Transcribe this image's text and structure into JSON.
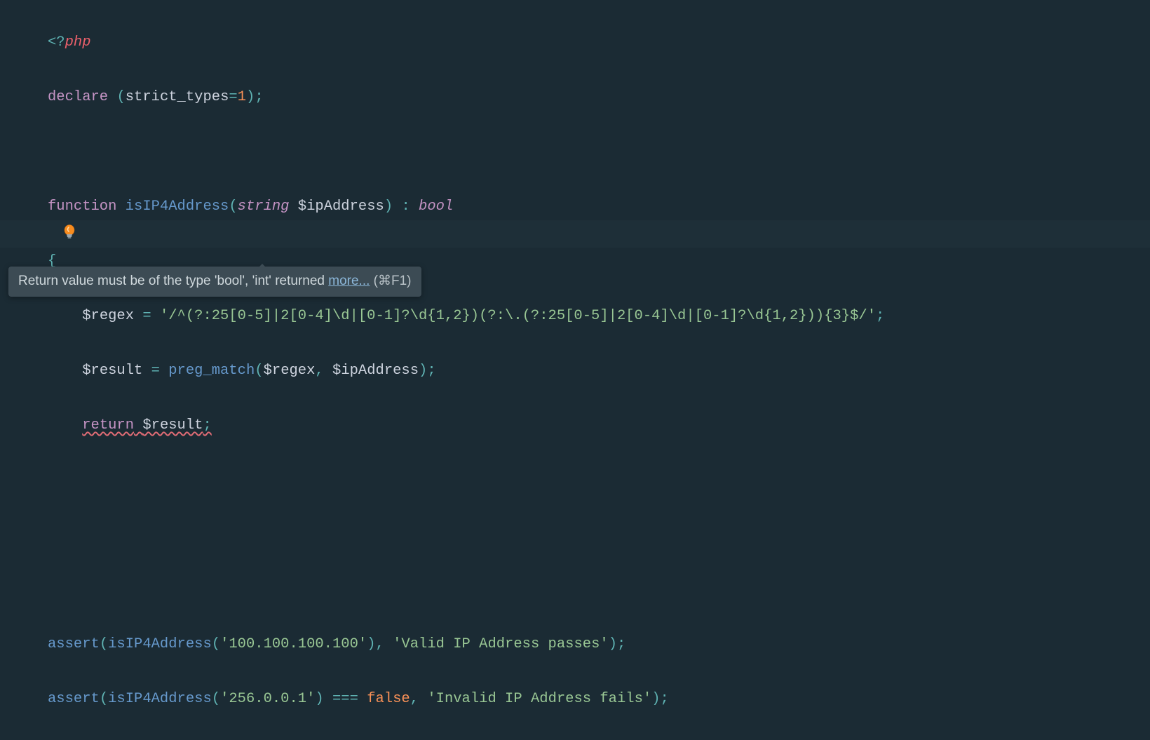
{
  "code": {
    "l1": {
      "open": "<?",
      "php": "php"
    },
    "l2": {
      "declare": "declare",
      "sp": " ",
      "op1": "(",
      "strict": "strict_types",
      "eq": "=",
      "one": "1",
      "op2": ")",
      "semi": ";"
    },
    "l4": {
      "function": "function",
      "name": "isIP4Address",
      "lp": "(",
      "ptype": "string",
      "param": "$ipAddress",
      "rp": ")",
      "colon": " : ",
      "rtype": "bool"
    },
    "l5": {
      "brace": "{"
    },
    "l6": {
      "var": "$regex",
      "eq": " = ",
      "str": "'/^(?:25[0-5]|2[0-4]\\d|[0-1]?\\d{1,2})(?:\\.(?:25[0-5]|2[0-4]\\d|[0-1]?\\d{1,2})){3}$/'",
      "semi": ";"
    },
    "l7": {
      "var": "$result",
      "eq": " = ",
      "fn": "preg_match",
      "lp": "(",
      "a1": "$regex",
      "comma": ", ",
      "a2": "$ipAddress",
      "rp": ")",
      "semi": ";"
    },
    "l8": {
      "return": "return",
      "sp": " ",
      "var": "$result",
      "semi": ";"
    },
    "l11": {
      "fn": "assert",
      "lp": "(",
      "call": "isIP4Address",
      "lp2": "(",
      "arg": "'100.100.100.100'",
      "rp2": ")",
      "comma": ", ",
      "msg": "'Valid IP Address passes'",
      "rp": ")",
      "semi": ";"
    },
    "l12": {
      "fn": "assert",
      "lp": "(",
      "call": "isIP4Address",
      "lp2": "(",
      "arg": "'256.0.0.1'",
      "rp2": ")",
      "eq3": " === ",
      "false": "false",
      "comma": ", ",
      "msg": "'Invalid IP Address fails'",
      "rp": ")",
      "semi": ";"
    }
  },
  "tooltip": {
    "text": "Return value must be of the type 'bool', 'int' returned ",
    "more": "more...",
    "shortcut": " (⌘F1)"
  }
}
